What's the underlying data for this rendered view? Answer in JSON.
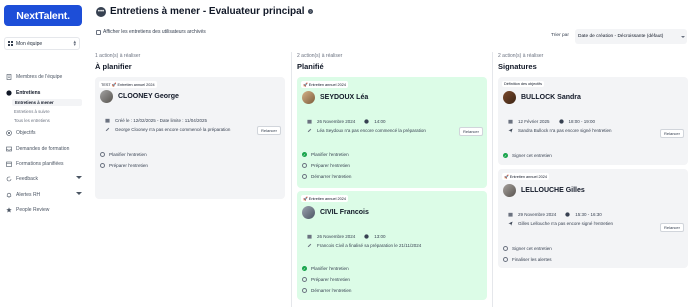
{
  "app": {
    "logo": "NextTalent."
  },
  "sidebar": {
    "team": "Mon équipe",
    "items": [
      {
        "label": "Membres de l'équipe",
        "icon": "document-icon"
      },
      {
        "label": "Entretiens",
        "icon": "chat-icon",
        "active": true
      },
      {
        "label": "Objectifs",
        "icon": "target-icon"
      },
      {
        "label": "Demandes de formation",
        "icon": "inbox-icon"
      },
      {
        "label": "Formations planifiées",
        "icon": "calendar-icon"
      },
      {
        "label": "Feedback",
        "icon": "refresh-icon"
      },
      {
        "label": "Alertes RH",
        "icon": "bell-icon"
      },
      {
        "label": "People Review",
        "icon": "star-icon"
      }
    ],
    "subitems": [
      "Entretiens à mener",
      "Entretiens à suivre",
      "Tous les entretiens"
    ]
  },
  "header": {
    "title": "Entretiens à mener - Evaluateur principal",
    "archive_label": "Afficher les entretiens des utilisateurs archivés",
    "sort_label": "Trier par",
    "sort_value": "Date de création - Décroissante (défaut)"
  },
  "columns": [
    {
      "count": "1 action(s) à réaliser",
      "title": "À planifier",
      "cards": [
        {
          "tag": "TEST 🚀 Entretien annuel 2024",
          "name": "CLOONEY George",
          "meta1": "Créé le : 12/02/2025 - Date limite : 11/04/2025",
          "meta2": "George Clooney n'a pas encore commencé la préparation",
          "relancer": "Relancer",
          "steps": [
            "Planifier l'entretien",
            "Préparer l'entretien"
          ]
        }
      ]
    },
    {
      "count": "2 action(s) à réaliser",
      "title": "Planifié",
      "cards": [
        {
          "tag": "🚀 Entretien annuel 2024",
          "name": "SEYDOUX Léa",
          "date": "26 Novembre 2024",
          "time": "14:00",
          "meta2": "Léa Seydoux n'a pas encore commencé la préparation",
          "relancer": "Relancer",
          "steps": [
            "Planifier l'entretien",
            "Préparer l'entretien",
            "Démarrer l'entretien"
          ]
        },
        {
          "tag": "🚀 Entretien annuel 2024",
          "name": "CIVIL Francois",
          "date": "26 Novembre 2024",
          "time": "13:00",
          "meta2": "Francois Civil a finalisé sa préparation le 21/11/2024",
          "steps": [
            "Planifier l'entretien",
            "Préparer l'entretien",
            "Démarrer l'entretien"
          ]
        }
      ]
    },
    {
      "count": "2 action(s) à réaliser",
      "title": "Signatures",
      "cards": [
        {
          "tag": "Définition des objectifs",
          "name": "BULLOCK Sandra",
          "date": "12 Février 2025",
          "time": "18:00 - 19:00",
          "meta2": "Sandra Bullock n'a pas encore signé l'entretien",
          "relancer": "Relancer",
          "steps": [
            "Signer cet entretien"
          ]
        },
        {
          "tag": "🚀 Entretien annuel 2024",
          "name": "LELLOUCHE Gilles",
          "date": "29 Novembre 2024",
          "time": "15:30 - 16:30",
          "meta2": "Gilles Lellouche n'a pas encore signé l'entretien",
          "relancer": "Relancer",
          "steps": [
            "Signer cet entretien",
            "Finaliser les alertes"
          ]
        }
      ]
    }
  ],
  "colors": {
    "brand": "#1d4ed8",
    "green_card": "#dcfce7",
    "grey_card": "#f3f4f6",
    "check": "#16a34a"
  }
}
